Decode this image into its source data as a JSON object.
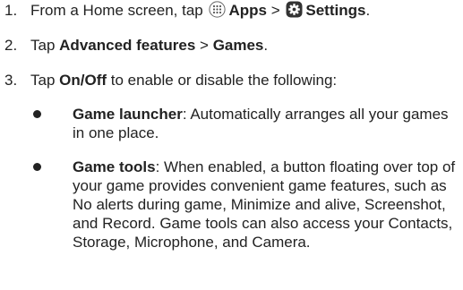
{
  "steps": [
    {
      "number": "1.",
      "prefix": "From a Home screen, tap",
      "apps_label": "Apps",
      "separator": ">",
      "settings_label": "Settings",
      "suffix": "."
    },
    {
      "number": "2.",
      "prefix": "Tap",
      "advanced_label": "Advanced features",
      "separator": ">",
      "games_label": "Games",
      "suffix": "."
    },
    {
      "number": "3.",
      "prefix": "Tap",
      "onoff_label": "On/Off",
      "suffix": "to enable or disable the following:"
    }
  ],
  "bullets": [
    {
      "term": "Game launcher",
      "description": ": Automatically arranges all your games in one place."
    },
    {
      "term": "Game tools",
      "description": ": When enabled, a button floating over top of your game provides convenient game features, such as No alerts during game, Minimize and alive, Screenshot, and Record. Game tools can also access your Contacts, Storage, Microphone, and Camera."
    }
  ],
  "icons": {
    "apps": "apps-grid-icon",
    "settings": "settings-gear-icon"
  },
  "colors": {
    "text": "#222222",
    "icon_bg": "#333333"
  }
}
